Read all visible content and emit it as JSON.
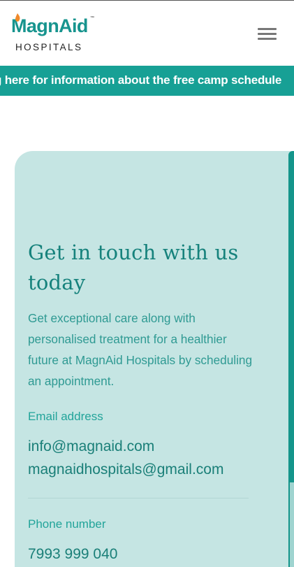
{
  "header": {
    "logo_word_magn": "Magn",
    "logo_word_aid": "Aid",
    "logo_tm": "™",
    "logo_sub": "HOSPITALS",
    "menu_icon": "hamburger-menu-icon"
  },
  "ticker": {
    "text": "g here for information about the free camp schedule"
  },
  "contact": {
    "heading": "Get in touch with us today",
    "description": "Get exceptional care along with personalised treatment for a healthier future at MagnAid Hospitals by scheduling an appointment.",
    "email_label": "Email address",
    "emails": [
      "info@magnaid.com",
      "magnaidhospitals@gmail.com"
    ],
    "phone_label": "Phone number",
    "phone": "7993 999 040"
  },
  "colors": {
    "brand_teal": "#17a095",
    "card_bg": "#c5e5e3",
    "heading_teal": "#16827c"
  }
}
